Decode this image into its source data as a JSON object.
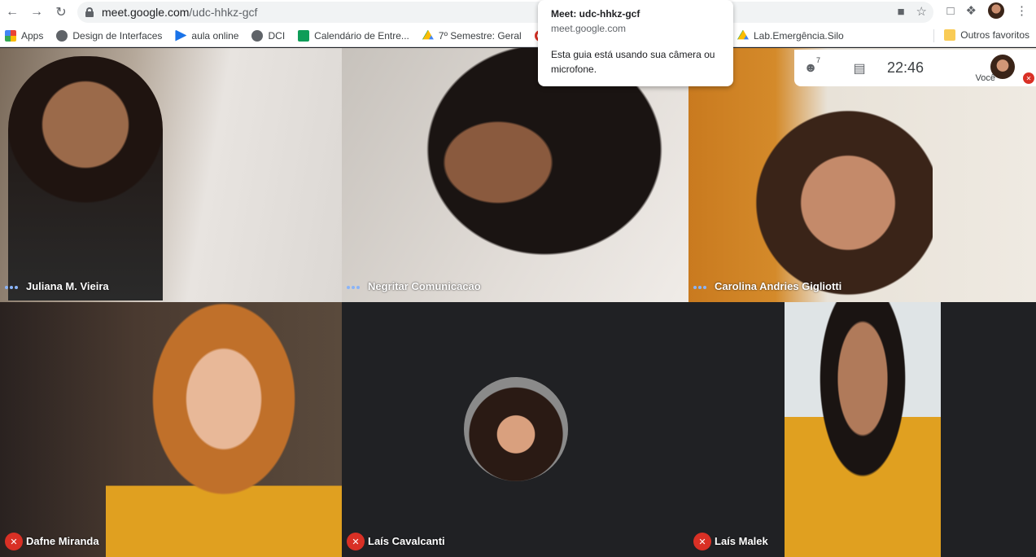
{
  "browser": {
    "url_host": "meet.google.com",
    "url_path": "/udc-hhkz-gcf",
    "bookmarks": [
      {
        "label": "Apps",
        "icon": "apps-grid-icon",
        "color": "#ea4335"
      },
      {
        "label": "Design de Interfaces",
        "icon": "globe-icon",
        "color": "#5f6368"
      },
      {
        "label": "aula online",
        "icon": "play-icon",
        "color": "#1a73e8"
      },
      {
        "label": "DCI",
        "icon": "globe-icon",
        "color": "#5f6368"
      },
      {
        "label": "Calendário de Entre...",
        "icon": "sheets-icon",
        "color": "#0f9d58"
      },
      {
        "label": "7º Semestre: Geral",
        "icon": "drive-icon",
        "color": "#fbbc04"
      },
      {
        "label": "O",
        "icon": "opera-icon",
        "color": "#d93025"
      },
      {
        "label": "Lab.Emergência.Silo",
        "icon": "drive-icon",
        "color": "#fbbc04"
      }
    ],
    "other_bookmarks": "Outros favoritos"
  },
  "popup": {
    "title": "Meet: udc-hhkz-gcf",
    "host": "meet.google.com",
    "message": "Esta guia está usando sua câmera ou microfone."
  },
  "meet_bar": {
    "participants_count": "7",
    "time": "22:46",
    "self_label": "Você"
  },
  "participants": [
    {
      "name": "Juliana M. Vieira",
      "muted": false
    },
    {
      "name": "Negritar Comunicacao",
      "muted": false
    },
    {
      "name": "Carolina Andries Gigliotti",
      "muted": false
    },
    {
      "name": "Dafne Miranda",
      "muted": true
    },
    {
      "name": "Laís Cavalcanti",
      "muted": true
    },
    {
      "name": "Laís Malek",
      "muted": true
    }
  ]
}
